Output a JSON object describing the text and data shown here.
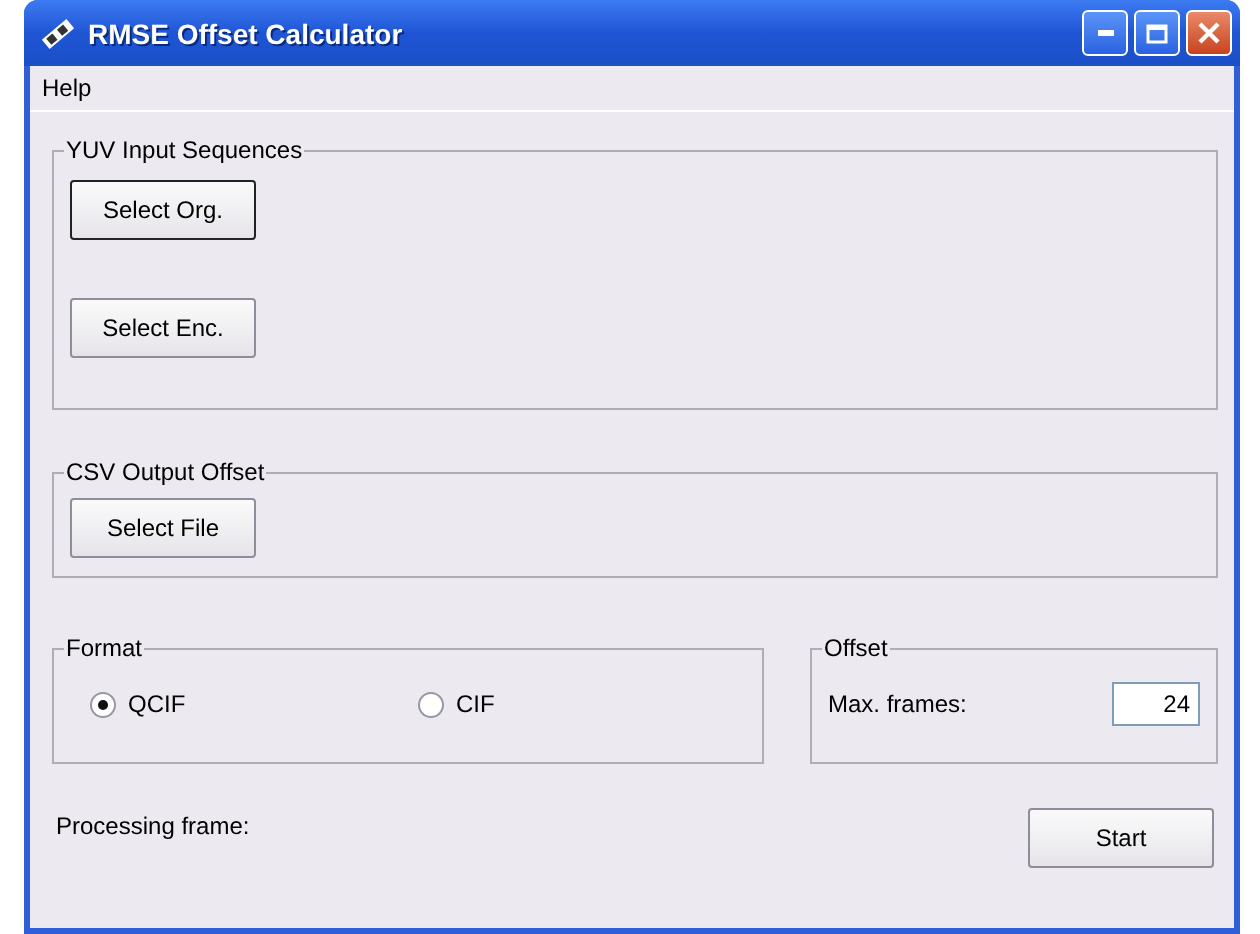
{
  "window": {
    "title": "RMSE Offset Calculator"
  },
  "menu": [
    "Help"
  ],
  "input_group": {
    "title": "YUV Input Sequences",
    "buttons": [
      {
        "label": "Select Org.",
        "focused": true
      },
      {
        "label": "Select Enc.",
        "focused": false
      }
    ]
  },
  "output_group": {
    "title": "CSV Output Offset",
    "button": "Select File"
  },
  "format_group": {
    "title": "Format",
    "options": [
      {
        "label": "QCIF",
        "selected": true
      },
      {
        "label": "CIF",
        "selected": false
      }
    ]
  },
  "offset_group": {
    "title": "Offset",
    "label": "Max. frames:",
    "value": "24"
  },
  "status": "Processing frame:",
  "start_button": "Start"
}
